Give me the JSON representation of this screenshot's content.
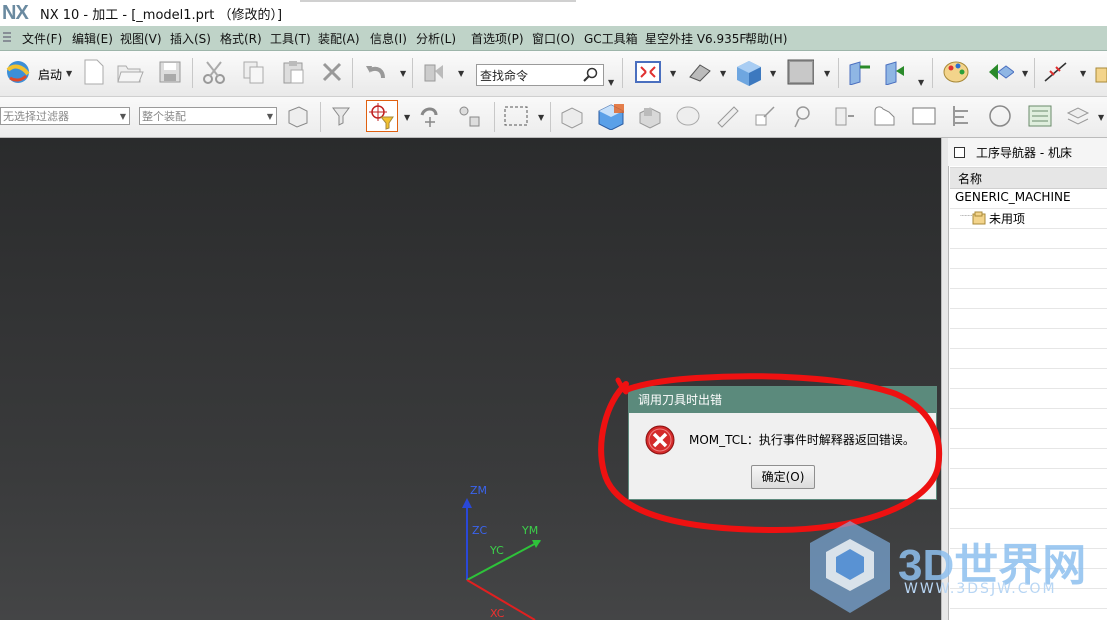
{
  "window": {
    "logo": "NX",
    "title": "NX 10 - 加工 - [_model1.prt （修改的）]"
  },
  "menubar": {
    "items": [
      "文件(F)",
      "编辑(E)",
      "视图(V)",
      "插入(S)",
      "格式(R)",
      "工具(T)",
      "装配(A)",
      "信息(I)",
      "分析(L)",
      "首选项(P)",
      "窗口(O)",
      "GC工具箱",
      "星空外挂 V6.935F",
      "帮助(H)"
    ]
  },
  "toolbar": {
    "start_label": "启动",
    "search_placeholder": "查找命令"
  },
  "selection_bar": {
    "filter_value": "无选择过滤器",
    "scope_value": "整个装配"
  },
  "viewport": {
    "axes": {
      "zm": "ZM",
      "zc": "ZC",
      "yc": "YC",
      "ym": "YM",
      "xc": "XC"
    },
    "colors": {
      "z": "#2a48d8",
      "y": "#2ec23a",
      "x": "#e02020"
    }
  },
  "navigator": {
    "title": "工序导航器 - 机床",
    "column_header": "名称",
    "rows": [
      {
        "label": "GENERIC_MACHINE",
        "icon": "machine"
      },
      {
        "label": "未用项",
        "icon": "folder-icon"
      }
    ]
  },
  "dialog": {
    "title": "调用刀具时出错",
    "message": "MOM_TCL：执行事件时解释器返回错误。",
    "ok_label": "确定(O)",
    "icon": "error-icon"
  },
  "annotation": {
    "color": "#ee1111"
  },
  "watermark": {
    "brand": "3D世界网",
    "url": "WWW.3DSJW.COM"
  }
}
